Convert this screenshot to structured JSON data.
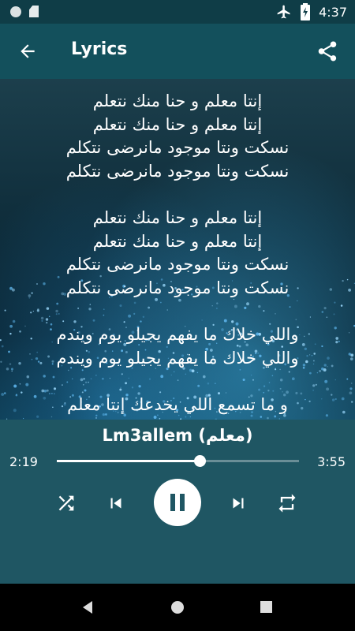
{
  "status_bar": {
    "time": "4:37"
  },
  "app_bar": {
    "title": "Lyrics"
  },
  "lyrics": {
    "stanza1": [
      "إنتا معلم و حنا منك نتعلم",
      "إنتا معلم و حنا منك نتعلم",
      "نسكت ونتا موجود مانرضى نتكلم",
      "نسكت ونتا موجود مانرضى نتكلم"
    ],
    "stanza2": [
      "إنتا معلم و حنا منك نتعلم",
      "إنتا معلم و حنا منك نتعلم",
      "نسكت ونتا موجود مانرضى نتكلم",
      "نسكت ونتا موجود مانرضى نتكلم"
    ],
    "stanza3": [
      "واللي خلاك ما يفهم يجيلو يوم ويندم",
      "واللي خلاك ما يفهم يجيلو يوم ويندم"
    ],
    "stanza4": [
      "و ما تسمع اللي يخدعك إنتا معلم"
    ]
  },
  "player": {
    "song_title": "Lm3allem (معلم)",
    "elapsed": "2:19",
    "duration": "3:55",
    "progress": 0.59,
    "state": "playing"
  },
  "colors": {
    "status_bar": "#0f3d47",
    "app_bar": "#13505c",
    "player_bg": "#1f5663",
    "accent": "#ffffff"
  },
  "icons": [
    "back-arrow-icon",
    "share-icon",
    "shuffle-icon",
    "skip-previous-icon",
    "pause-icon",
    "skip-next-icon",
    "repeat-icon",
    "airplane-icon",
    "battery-icon",
    "nav-back-icon",
    "nav-home-icon",
    "nav-recents-icon"
  ]
}
